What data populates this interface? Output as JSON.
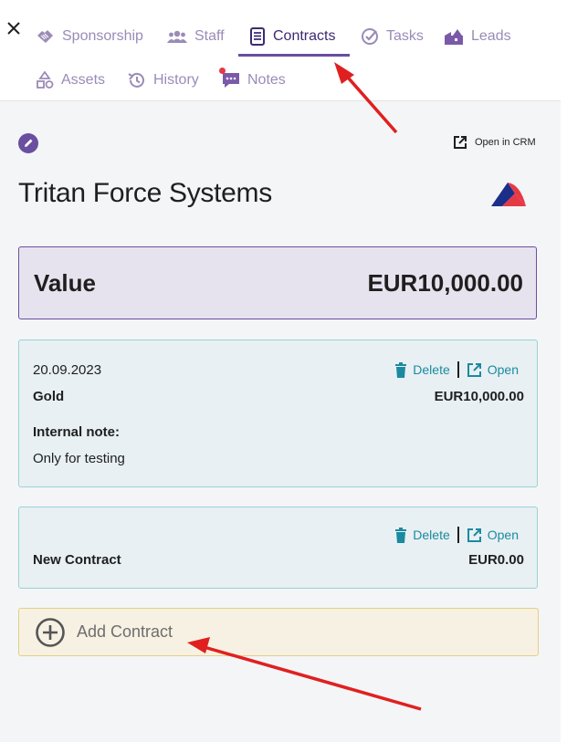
{
  "tabs": [
    {
      "label": "Sponsorship",
      "icon": "handshake-icon"
    },
    {
      "label": "Staff",
      "icon": "people-icon"
    },
    {
      "label": "Contracts",
      "icon": "contract-icon",
      "active": true
    },
    {
      "label": "Tasks",
      "icon": "check-circle-icon"
    },
    {
      "label": "Leads",
      "icon": "leads-icon"
    },
    {
      "label": "Assets",
      "icon": "shapes-icon"
    },
    {
      "label": "History",
      "icon": "history-icon"
    },
    {
      "label": "Notes",
      "icon": "chat-icon",
      "badge": true
    }
  ],
  "header": {
    "open_crm_label": "Open in CRM",
    "company_name": "Tritan Force Systems"
  },
  "value_card": {
    "label": "Value",
    "amount": "EUR10,000.00"
  },
  "contracts": [
    {
      "date": "20.09.2023",
      "name": "Gold",
      "amount": "EUR10,000.00",
      "note_label": "Internal note:",
      "note_text": "Only for testing",
      "delete_label": "Delete",
      "open_label": "Open"
    },
    {
      "date": "",
      "name": "New Contract",
      "amount": "EUR0.00",
      "delete_label": "Delete",
      "open_label": "Open"
    }
  ],
  "add_contract_label": "Add Contract",
  "colors": {
    "accent": "#6a4ea0",
    "tab_inactive": "#9b8bb7",
    "tab_active": "#3d2a74",
    "link": "#1b8aa0",
    "annotation_arrow": "#e02020"
  }
}
